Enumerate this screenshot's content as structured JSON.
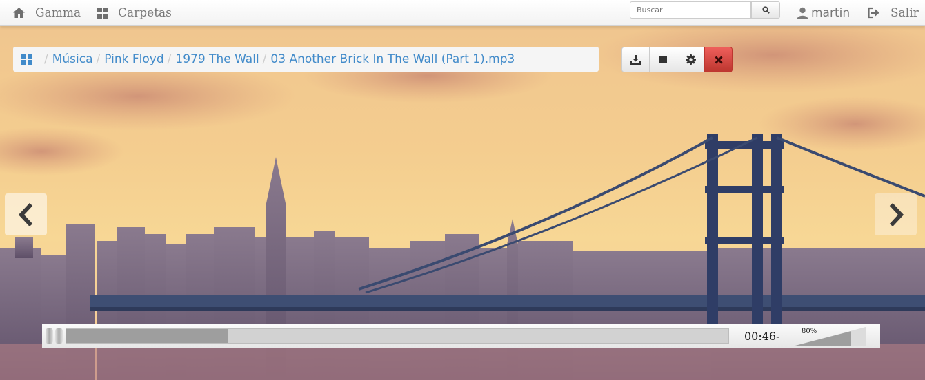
{
  "navbar": {
    "home_label": "Gamma",
    "folders_label": "Carpetas",
    "search_placeholder": "Buscar",
    "user_label": "martin",
    "logout_label": "Salir"
  },
  "breadcrumb": [
    "Música",
    "Pink Floyd",
    "1979 The Wall",
    "03 Another Brick In The Wall (Part 1).mp3"
  ],
  "breadcrumb_separator": "/",
  "toolbar": {
    "icons": [
      "download-icon",
      "stop-icon",
      "gear-icon",
      "close-icon"
    ]
  },
  "carousel": {
    "prev_icon": "chevron-left-icon",
    "next_icon": "chevron-right-icon"
  },
  "player": {
    "time": "00:46-",
    "volume": "80%",
    "progress": 0.245,
    "volume_level": 0.8
  },
  "colors": {
    "link": "#428bca",
    "danger": "#d9534f"
  }
}
